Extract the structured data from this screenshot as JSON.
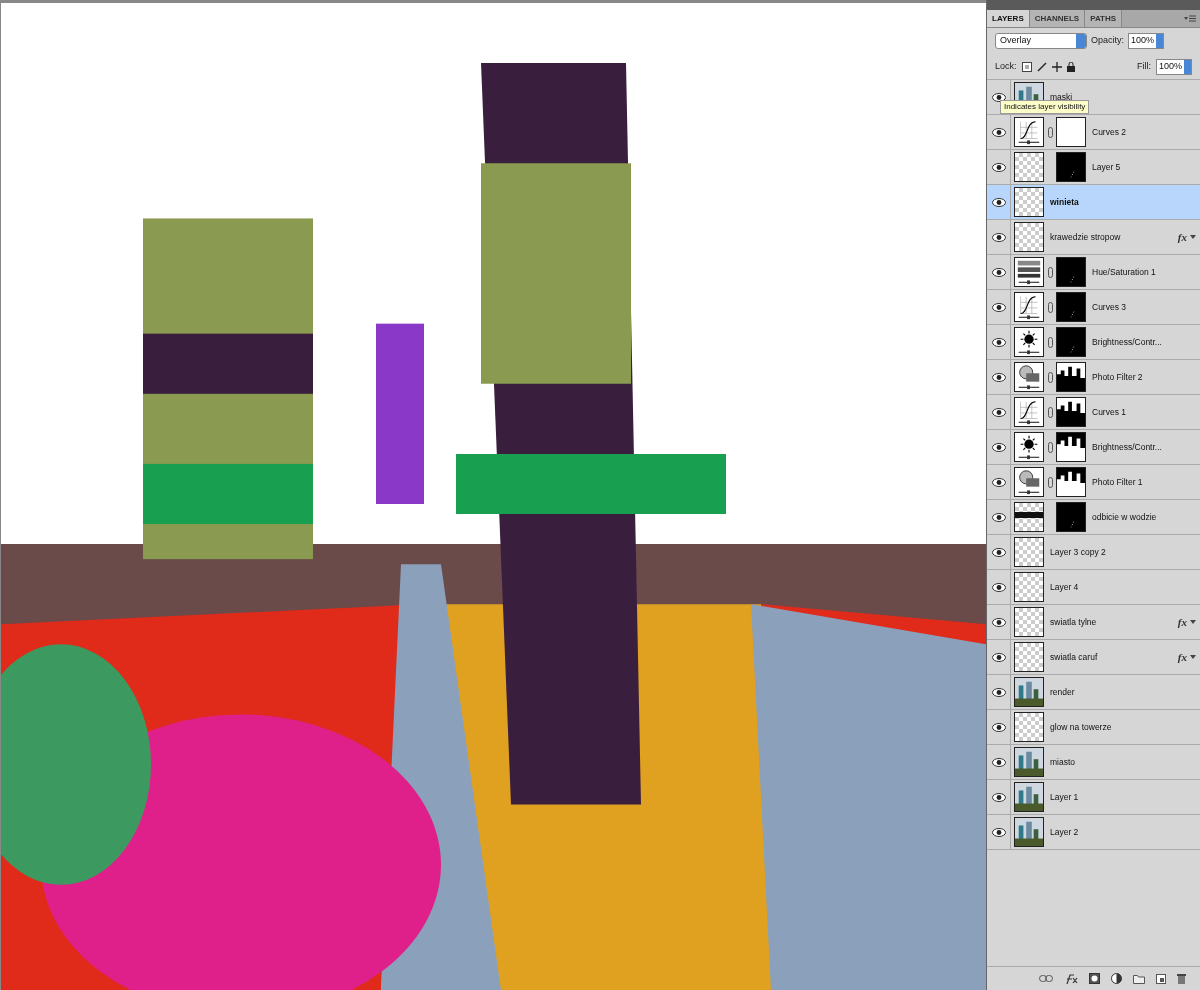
{
  "panel": {
    "tabs": [
      {
        "label": "LAYERS",
        "selected": true
      },
      {
        "label": "CHANNELS",
        "selected": false
      },
      {
        "label": "PATHS",
        "selected": false
      }
    ],
    "blend_mode": "Overlay",
    "opacity_label": "Opacity:",
    "opacity": "100%",
    "lock_label": "Lock:",
    "fill_label": "Fill:",
    "fill": "100%",
    "tooltip": "Indicates layer visibility",
    "layers": [
      {
        "name": "maski",
        "selected": false,
        "visible": true
      },
      {
        "name": "Curves 2",
        "selected": false,
        "visible": true,
        "thumbnail": {
          "kind": "curves"
        },
        "mask": {
          "kind": "white"
        },
        "linked": true
      },
      {
        "name": "Layer 5",
        "selected": false,
        "visible": true,
        "thumbnail": {
          "kind": "transparent"
        },
        "mask": {
          "kind": "black"
        },
        "linked": false
      },
      {
        "name": "winieta",
        "selected": true,
        "visible": true,
        "thumbnail": {
          "kind": "transparent"
        }
      },
      {
        "name": "krawedzie stropow",
        "selected": false,
        "visible": true,
        "thumbnail": {
          "kind": "transparent"
        },
        "effects_badge": "fx"
      },
      {
        "name": "Hue/Saturation 1",
        "selected": false,
        "visible": true,
        "thumbnail": {
          "kind": "hue"
        },
        "mask": {
          "kind": "black"
        },
        "linked": true
      },
      {
        "name": "Curves 3",
        "selected": false,
        "visible": true,
        "thumbnail": {
          "kind": "curves"
        },
        "mask": {
          "kind": "black"
        },
        "linked": true
      },
      {
        "name": "Brightness/Contr...",
        "selected": false,
        "visible": true,
        "thumbnail": {
          "kind": "brightness"
        },
        "mask": {
          "kind": "black"
        },
        "linked": true
      },
      {
        "name": "Photo Filter 2",
        "selected": false,
        "visible": true,
        "thumbnail": {
          "kind": "photo-filter"
        },
        "mask": {
          "kind": "skyline"
        },
        "linked": true
      },
      {
        "name": "Curves 1",
        "selected": false,
        "visible": true,
        "thumbnail": {
          "kind": "curves"
        },
        "mask": {
          "kind": "skyline"
        },
        "linked": true
      },
      {
        "name": "Brightness/Contr...",
        "selected": false,
        "visible": true,
        "thumbnail": {
          "kind": "brightness"
        },
        "mask": {
          "kind": "skyline-inverse"
        },
        "linked": true
      },
      {
        "name": "Photo Filter 1",
        "selected": false,
        "visible": true,
        "thumbnail": {
          "kind": "photo-filter"
        },
        "mask": {
          "kind": "skyline-inverse"
        },
        "linked": true
      },
      {
        "name": "odbicie w wodzie",
        "selected": false,
        "visible": true,
        "thumbnail": {
          "kind": "band"
        },
        "mask": {
          "kind": "black"
        },
        "linked": false
      },
      {
        "name": "Layer 3 copy 2",
        "selected": false,
        "visible": true,
        "thumbnail": {
          "kind": "transparent"
        }
      },
      {
        "name": "Layer 4",
        "selected": false,
        "visible": true,
        "thumbnail": {
          "kind": "transparent"
        }
      },
      {
        "name": "swiatla tylne",
        "selected": false,
        "visible": true,
        "thumbnail": {
          "kind": "transparent"
        },
        "effects_badge": "fx"
      },
      {
        "name": "swiatla caruf",
        "selected": false,
        "visible": true,
        "thumbnail": {
          "kind": "transparent"
        },
        "effects_badge": "fx"
      },
      {
        "name": "render",
        "selected": false,
        "visible": true
      },
      {
        "name": "glow na towerze",
        "selected": false,
        "visible": true,
        "thumbnail": {
          "kind": "transparent"
        }
      },
      {
        "name": "miasto",
        "selected": false,
        "visible": true
      },
      {
        "name": "Layer 1",
        "selected": false,
        "visible": true
      },
      {
        "name": "Layer 2",
        "selected": false,
        "visible": true
      }
    ]
  }
}
